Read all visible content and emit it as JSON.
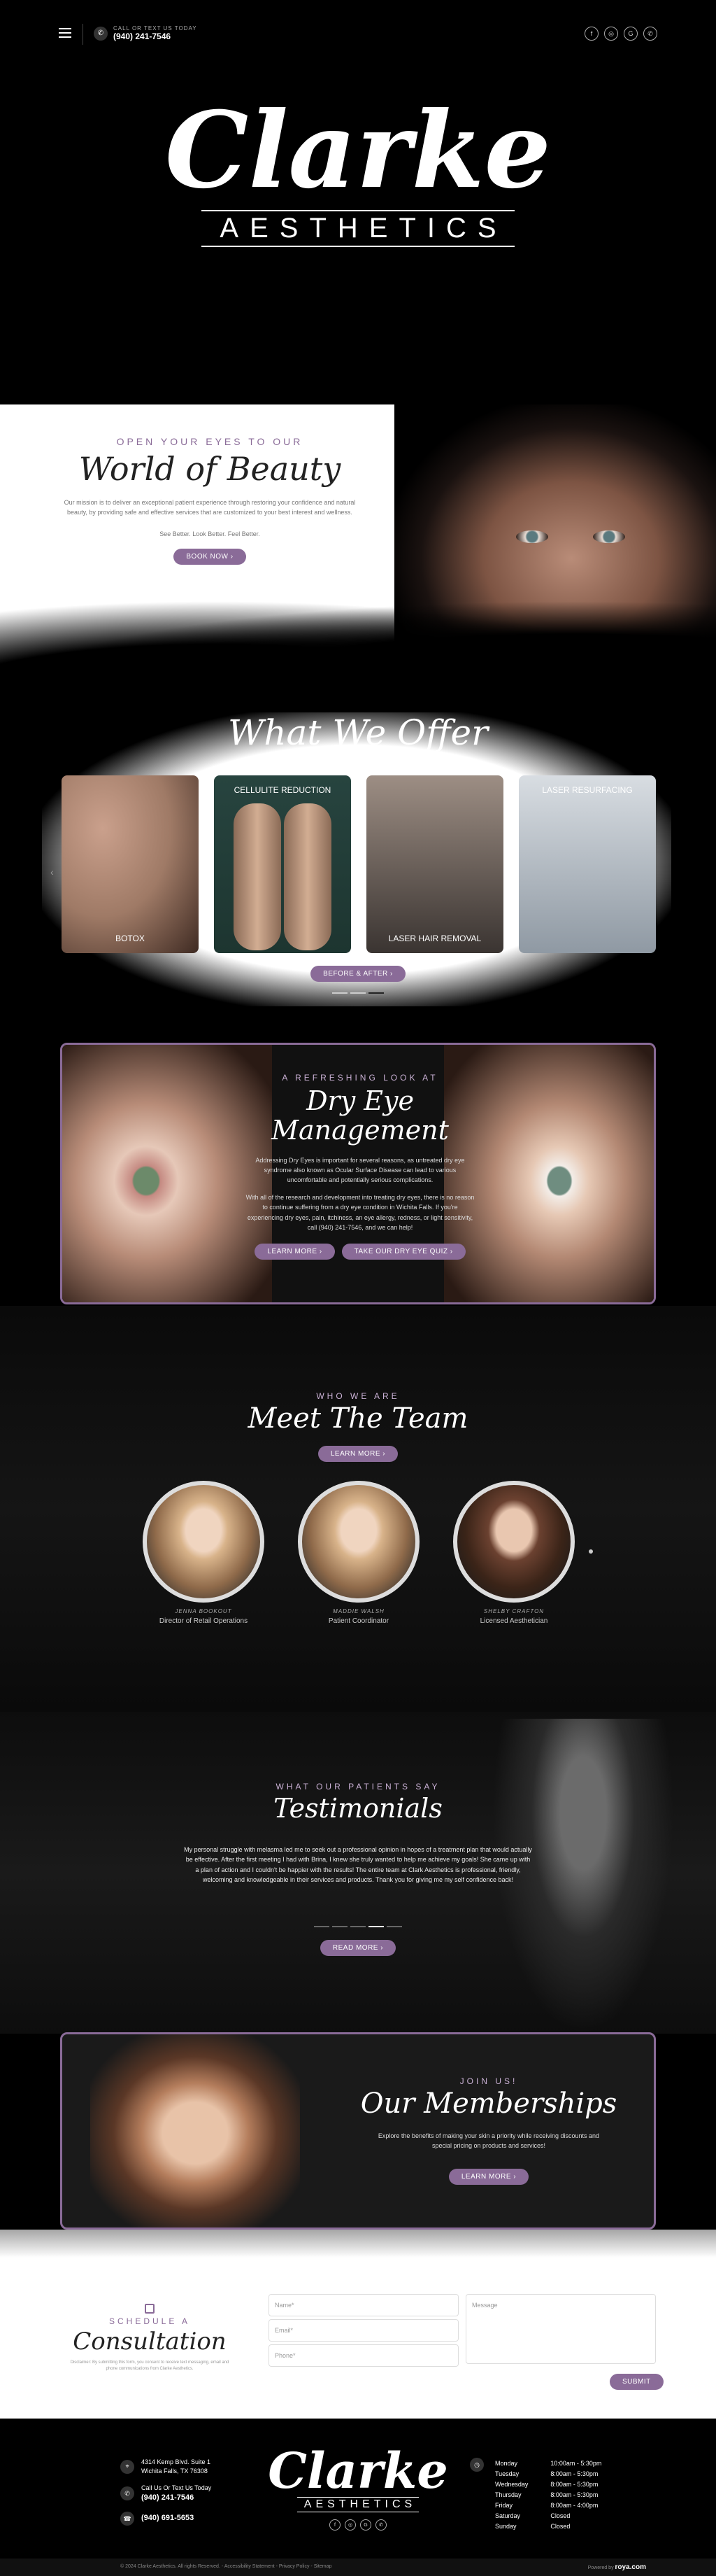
{
  "header": {
    "call_label": "CALL OR TEXT US TODAY",
    "phone": "(940) 241-7546",
    "socials": [
      "f",
      "◎",
      "G",
      "✆"
    ]
  },
  "logo": {
    "script": "Clarke",
    "sub": "AESTHETICS"
  },
  "beauty": {
    "eyebrow": "OPEN YOUR EYES TO OUR",
    "title": "World of Beauty",
    "body": "Our mission is to deliver an exceptional patient experience through restoring your confidence and natural beauty, by providing safe and effective services that are customized to your best interest and wellness.",
    "tagline": "See Better. Look Better. Feel Better.",
    "button": "BOOK NOW ›"
  },
  "offer": {
    "title": "What We Offer",
    "cards": [
      "BOTOX",
      "CELLULITE REDUCTION",
      "LASER HAIR REMOVAL",
      "LASER RESURFACING"
    ],
    "button": "BEFORE & AFTER ›"
  },
  "dryeye": {
    "eyebrow": "A REFRESHING LOOK AT",
    "title": "Dry Eye Management",
    "p1": "Addressing Dry Eyes is important for several reasons, as untreated dry eye syndrome also known as Ocular Surface Disease can lead to various uncomfortable and potentially serious complications.",
    "p2": "With all of the research and development into treating dry eyes, there is no reason to continue suffering from a dry eye condition in Wichita Falls. If you're experiencing dry eyes, pain, itchiness, an eye allergy, redness, or light sensitivity, call (940) 241-7546, and we can help!",
    "btn1": "LEARN MORE ›",
    "btn2": "TAKE OUR DRY EYE QUIZ ›"
  },
  "team": {
    "eyebrow": "WHO WE ARE",
    "title": "Meet The Team",
    "button": "LEARN MORE ›",
    "members": [
      {
        "name": "JENNA BOOKOUT",
        "role": "Director of Retail Operations"
      },
      {
        "name": "MADDIE WALSH",
        "role": "Patient Coordinator"
      },
      {
        "name": "SHELBY CRAFTON",
        "role": "Licensed Aesthetician"
      }
    ]
  },
  "testimonials": {
    "eyebrow": "WHAT OUR PATIENTS SAY",
    "title": "Testimonials",
    "quote": "My personal struggle with melasma led me to seek out a professional opinion in hopes of a treatment plan that would actually be effective. After the first meeting I had with Brina, I knew she truly wanted to help me achieve my goals! She came up with a plan of action and I couldn't be happier with the results! The entire team at Clark Aesthetics is professional, friendly, welcoming and knowledgeable in their services and products. Thank you for giving me my self confidence back!",
    "button": "READ MORE ›"
  },
  "memberships": {
    "eyebrow": "JOIN US!",
    "title": "Our Memberships",
    "body": "Explore the benefits of making your skin a priority while receiving discounts and special pricing on products and services!",
    "button": "LEARN MORE ›"
  },
  "consult": {
    "eyebrow": "SCHEDULE A",
    "title": "Consultation",
    "disclaimer": "Disclaimer: By submitting this form, you consent to receive text messaging, email and phone communications from Clarke Aesthetics.",
    "name_ph": "Name*",
    "email_ph": "Email*",
    "phone_ph": "Phone*",
    "message_ph": "Message",
    "submit": "SUBMIT"
  },
  "footer": {
    "address1": "4314 Kemp Blvd. Suite 1",
    "address2": "Wichita Falls, TX 76308",
    "call_label": "Call Us Or Text Us Today",
    "phone1": "(940) 241-7546",
    "phone2": "(940) 691-5653",
    "hours": [
      {
        "day": "Monday",
        "time": "10:00am - 5:30pm"
      },
      {
        "day": "Tuesday",
        "time": "8:00am - 5:30pm"
      },
      {
        "day": "Wednesday",
        "time": "8:00am - 5:30pm"
      },
      {
        "day": "Thursday",
        "time": "8:00am - 5:30pm"
      },
      {
        "day": "Friday",
        "time": "8:00am - 4:00pm"
      },
      {
        "day": "Saturday",
        "time": "Closed"
      },
      {
        "day": "Sunday",
        "time": "Closed"
      }
    ],
    "copyright": "© 2024 Clarke Aesthetics. All rights Reserved. - Accessibility Statement - Privacy Policy - Sitemap",
    "powered": "Powered by",
    "brand": "roya.com"
  }
}
